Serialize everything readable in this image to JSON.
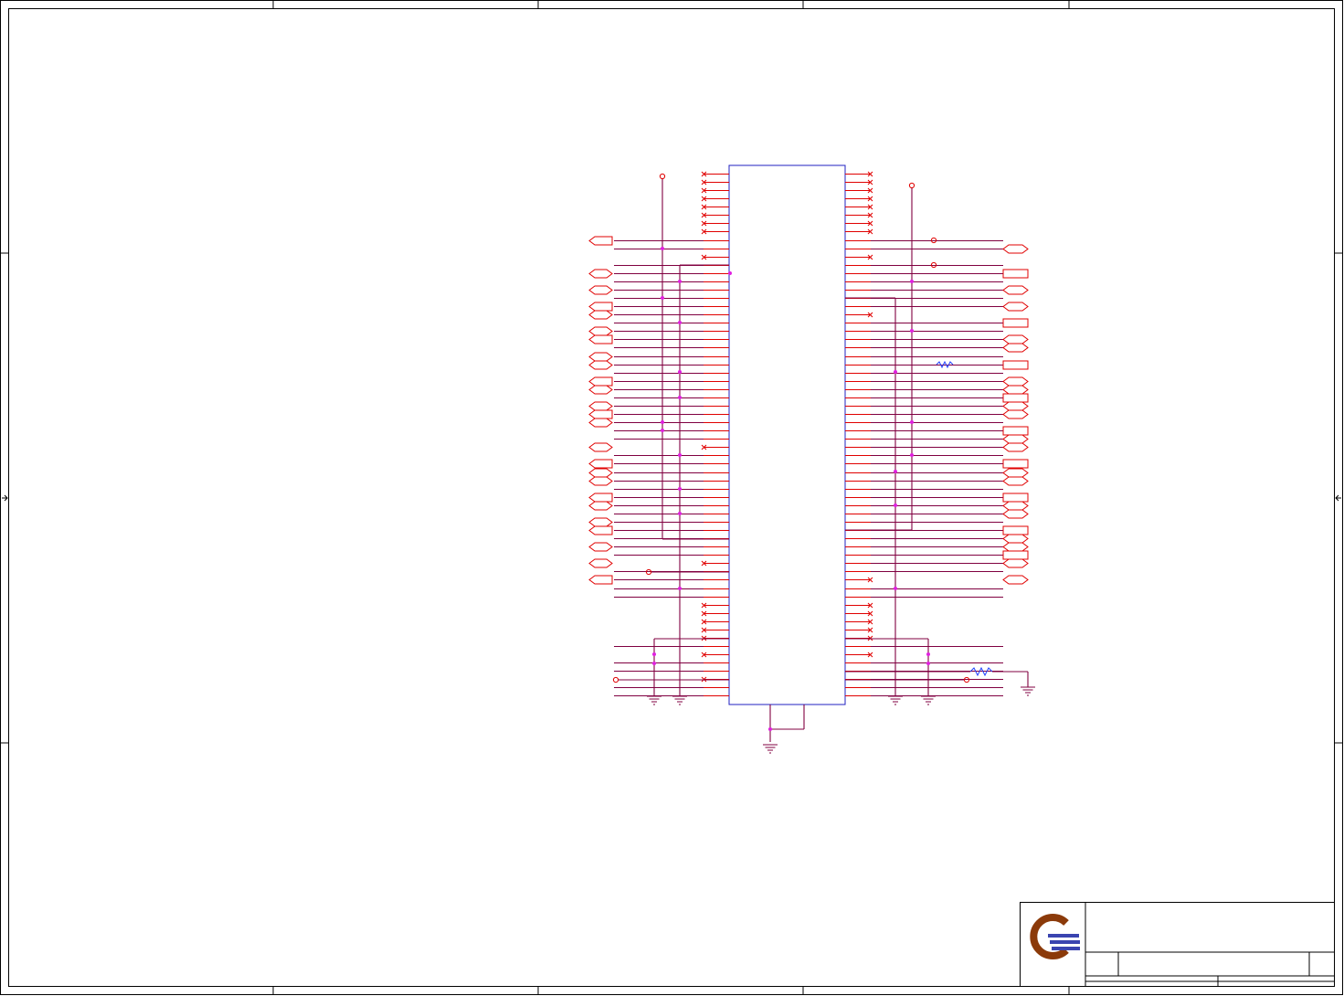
{
  "title_block": {
    "logo": "company-logo",
    "colors": {
      "logo_ring": "#8b3a0a",
      "logo_bars": "#3a44b0"
    }
  },
  "colors": {
    "wire": "#800040",
    "pin": "#e00000",
    "chip_outline": "#2020c0",
    "junction": "#e020e0",
    "border": "#000000"
  }
}
